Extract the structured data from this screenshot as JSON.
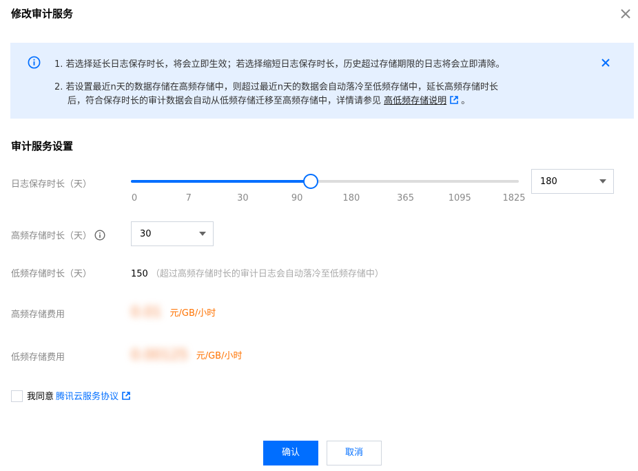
{
  "dialog": {
    "title": "修改审计服务"
  },
  "notice": {
    "line1": "1. 若选择延长日志保存时长，将会立即生效；若选择缩短日志保存时长，历史超过存储期限的日志将会立即清除。",
    "line2": "2. 若设置最近n天的数据存储在高频存储中，则超过最近n天的数据会自动落冷至低频存储中，延长高频存储时长",
    "line3_prefix": "后，符合保存时长的审计数据会自动从低频存储迁移至高频存储中，详情请参见 ",
    "line3_link": "高低频存储说明",
    "line3_suffix": " 。"
  },
  "section": {
    "title": "审计服务设置"
  },
  "retention": {
    "label": "日志保存时长（天）",
    "ticks": [
      "0",
      "7",
      "30",
      "90",
      "180",
      "365",
      "1095",
      "1825"
    ],
    "selected_index": 4,
    "select_value": "180"
  },
  "hot_storage": {
    "label": "高频存储时长（天）",
    "select_value": "30"
  },
  "cold_storage": {
    "label": "低频存储时长（天）",
    "value": "150",
    "note": "（超过高频存储时长的审计日志会自动落冷至低频存储中）"
  },
  "hot_fee": {
    "label": "高频存储费用",
    "value": "0.01",
    "unit": "元/GB/小时"
  },
  "cold_fee": {
    "label": "低频存储费用",
    "value": "0.00125",
    "unit": "元/GB/小时"
  },
  "agreement": {
    "text": "我同意",
    "link": "腾讯云服务协议",
    "checked": false
  },
  "buttons": {
    "confirm": "确认",
    "cancel": "取消"
  },
  "colors": {
    "primary": "#006eff",
    "notice_bg": "#e5f0ff",
    "fee_unit": "#ff7200"
  }
}
